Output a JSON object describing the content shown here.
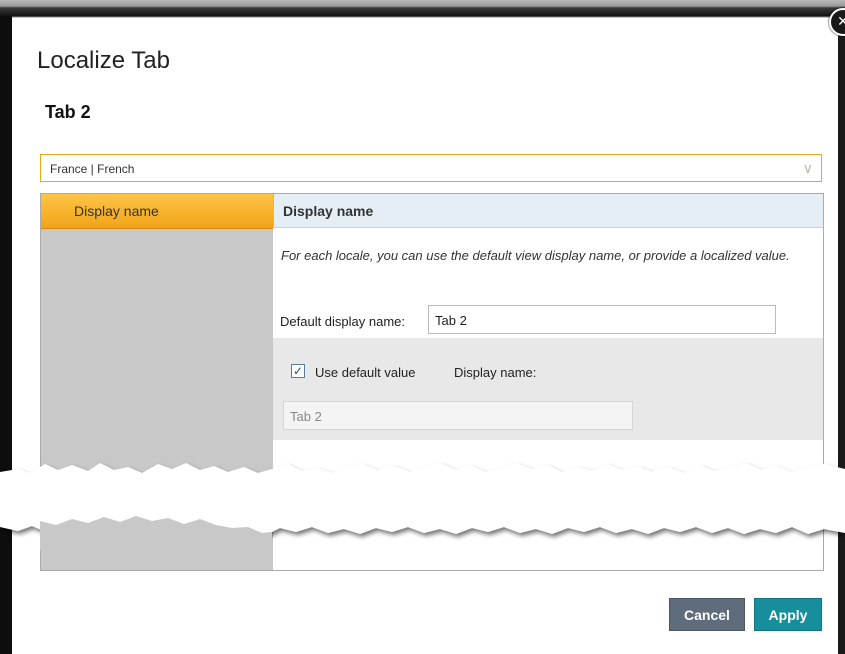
{
  "dialog": {
    "title": "Localize Tab",
    "subtitle": "Tab 2",
    "close_icon": "close-icon"
  },
  "locale_select": {
    "value": "France | French",
    "icon": "chevron-down-icon"
  },
  "left_nav": {
    "items": [
      {
        "label": "Display name",
        "active": true
      }
    ]
  },
  "section": {
    "header": "Display name",
    "help_text": "For each locale, you can use the default view display name, or provide a localized value.",
    "default_display_name_label": "Default display name:",
    "default_display_name_value": "Tab 2",
    "use_default_checked": true,
    "use_default_label": "Use default value",
    "display_name_label": "Display name:",
    "display_name_value": "Tab 2"
  },
  "buttons": {
    "cancel": "Cancel",
    "apply": "Apply"
  },
  "colors": {
    "accent_orange": "#f2a41a",
    "apply_teal": "#178e9c",
    "cancel_gray": "#5f6c7b"
  }
}
